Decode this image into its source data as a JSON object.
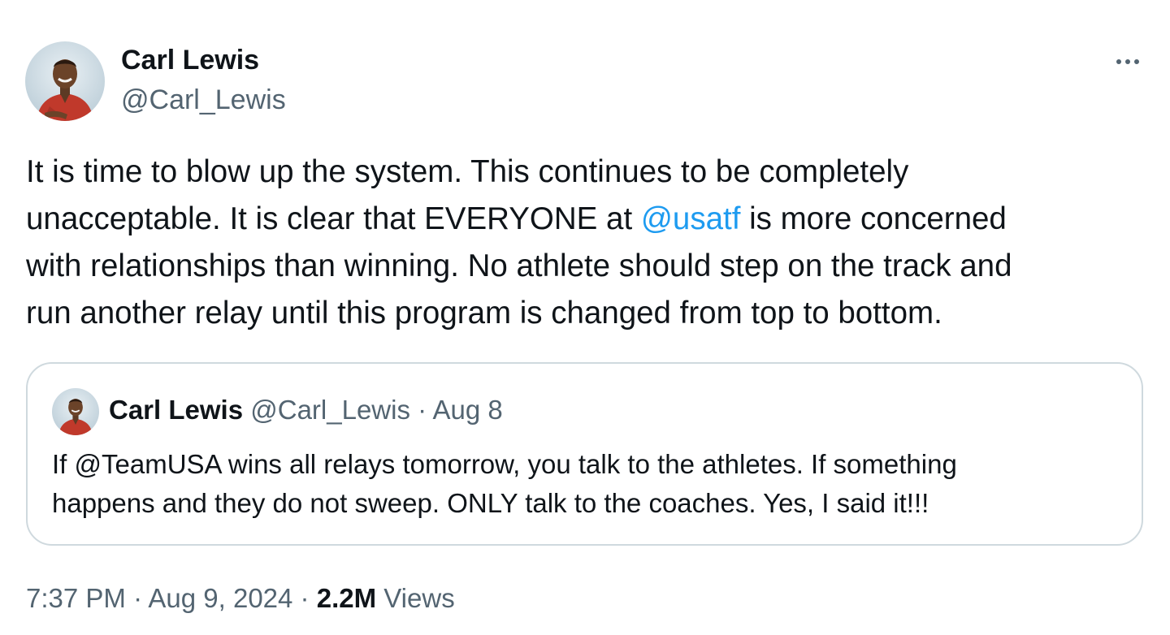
{
  "author": {
    "name": "Carl Lewis",
    "handle": "@Carl_Lewis"
  },
  "tweet": {
    "text_before_mention": "It is time to blow up the system. This continues to be completely\nunacceptable.  It is clear that EVERYONE at ",
    "mention": "@usatf",
    "text_after_mention": " is more concerned\nwith relationships than winning. No athlete should step on the track and\nrun another relay until this program is changed from top to bottom."
  },
  "quote": {
    "name": "Carl Lewis",
    "meta": " @Carl_Lewis · Aug 8",
    "text": "If @TeamUSA wins all relays tomorrow,  you talk to the athletes. If something\nhappens and they do not sweep.  ONLY talk to the coaches.  Yes, I said it!!!"
  },
  "footer": {
    "timestamp": "7:37 PM · Aug 9, 2024 · ",
    "views_count": "2.2M",
    "views_label": " Views"
  },
  "icons": {
    "more": "more-horizontal-icon"
  },
  "colors": {
    "text": "#0f1419",
    "secondary": "#536471",
    "link": "#1d9bf0",
    "border": "#cfd9de"
  }
}
